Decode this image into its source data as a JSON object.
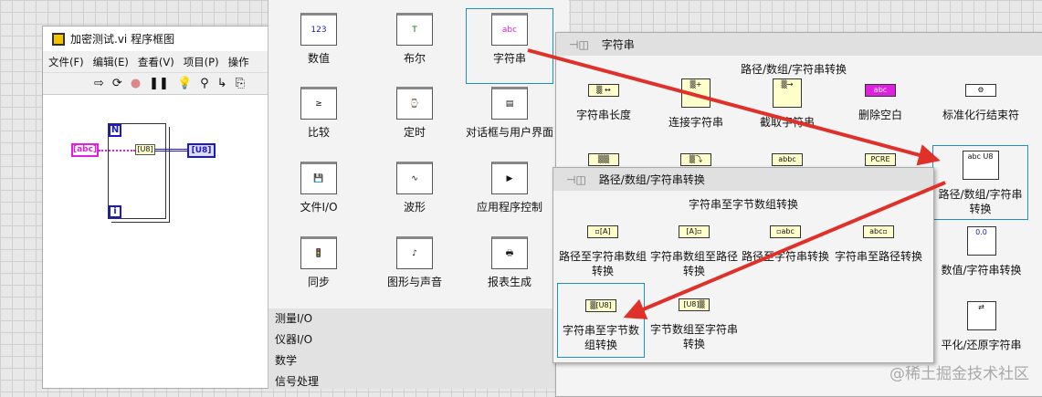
{
  "block_diagram": {
    "title": "加密测试.vi 程序框图",
    "menu": [
      "文件(F)",
      "编辑(E)",
      "查看(V)",
      "项目(P)",
      "操作"
    ],
    "toolbar": [
      "⇨",
      "⟳",
      "●",
      "❚❚",
      "💡",
      "⚲",
      "↳",
      "⎘"
    ],
    "nodes": {
      "loop_count": "N",
      "loop_index": "i",
      "string_const": "[abc]",
      "convert": "[U8]",
      "indicator": "[U8]"
    }
  },
  "functions_palette": {
    "items": [
      {
        "label": "数值",
        "icon": "123"
      },
      {
        "label": "布尔",
        "icon": "T"
      },
      {
        "label": "字符串",
        "icon": "abc"
      },
      {
        "label": "比较",
        "icon": "≥"
      },
      {
        "label": "定时",
        "icon": "⌚"
      },
      {
        "label": "对话框与用户界面",
        "icon": "▤"
      },
      {
        "label": "文件I/O",
        "icon": "💾"
      },
      {
        "label": "波形",
        "icon": "∿"
      },
      {
        "label": "应用程序控制",
        "icon": "▶"
      },
      {
        "label": "同步",
        "icon": "🚦"
      },
      {
        "label": "图形与声音",
        "icon": "♪"
      },
      {
        "label": "报表生成",
        "icon": "🖶"
      }
    ],
    "categories": [
      "测量I/O",
      "仪器I/O",
      "数学",
      "信号处理"
    ]
  },
  "string_palette": {
    "title": "字符串",
    "subtitle": "路径/数组/字符串转换",
    "items": [
      {
        "label": "字符串长度",
        "icon": "▒ ↔"
      },
      {
        "label": "连接字符串",
        "icon": "▒+"
      },
      {
        "label": "截取字符串",
        "icon": "▒→"
      },
      {
        "label": "删除空白",
        "icon": "abc"
      },
      {
        "label": "标准化行结束符",
        "icon": "⚙"
      }
    ],
    "row2_icons": [
      "▒▒",
      "▒⤵",
      "abbc",
      "PCRE"
    ],
    "side": [
      {
        "label": "路径/数组/字符串转换",
        "icon": "abc U8"
      },
      {
        "label": "数值/字符串转换",
        "icon": "0.0"
      },
      {
        "label": "平化/还原字符串",
        "icon": "⇄"
      }
    ]
  },
  "conversion_palette": {
    "title": "路径/数组/字符串转换",
    "subtitle": "字符串至字节数组转换",
    "items": [
      {
        "label": "路径至字符串数组转换",
        "icon": "▫[A]"
      },
      {
        "label": "字符串数组至路径转换",
        "icon": "[A]▫"
      },
      {
        "label": "路径至字符串转换",
        "icon": "▫abc"
      },
      {
        "label": "字符串至路径转换",
        "icon": "abc▫"
      },
      {
        "label": "字符串至字节数组转换",
        "icon": "▒[U8]"
      },
      {
        "label": "字节数组至字符串转换",
        "icon": "[U8]▒"
      }
    ]
  },
  "watermark": "@稀土掘金技术社区",
  "colors": {
    "arrow": "#e0302a",
    "selection": "#1a8fc8",
    "string_wire": "#e020e0",
    "array_wire": "#1a1acc"
  }
}
